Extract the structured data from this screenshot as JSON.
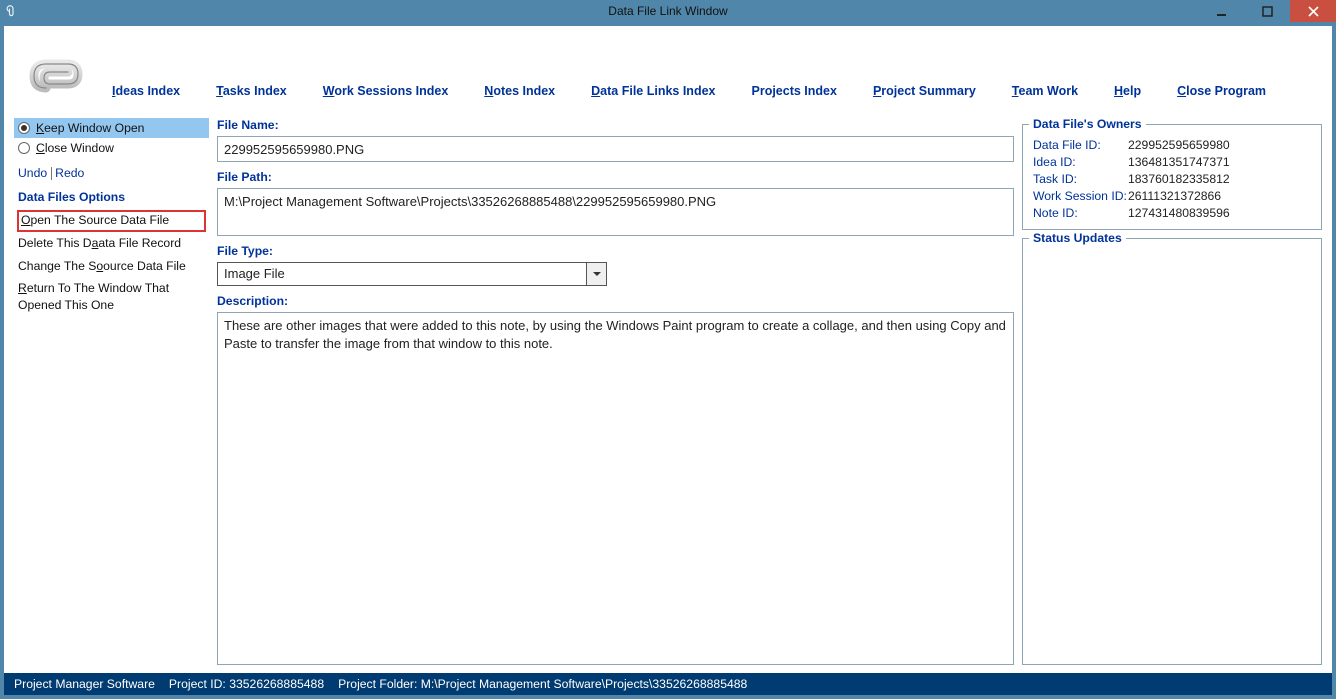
{
  "window": {
    "title": "Data File Link Window"
  },
  "menu": {
    "ideas": "deas Index",
    "tasks": "asks Index",
    "work": "ork Sessions Index",
    "notes": "otes Index",
    "datafile": "ata File Links Index",
    "projects": "Projects Index",
    "summary": "roject Summary",
    "team": "eam Work",
    "help": "elp",
    "close": "lose Program"
  },
  "sidebar": {
    "keep_open": "eep Window Open",
    "close_win": "lose Window",
    "undo": "Undo",
    "redo": "Redo",
    "section": "Data Files Options",
    "open_source": "pen The Source Data File",
    "delete_record": "Delete This D",
    "delete_record2": "ata File Record",
    "change_source": "Change The S",
    "change_source2": "ource Data File",
    "return_txt": "R",
    "return_txt2": "eturn To The Window That Opened This One"
  },
  "fields": {
    "filename_label": "File Name:",
    "filename_value": "229952595659980.PNG",
    "filepath_label": "File Path:",
    "filepath_value": "M:\\Project Management Software\\Projects\\33526268885488\\229952595659980.PNG",
    "filetype_label": "File Type:",
    "filetype_value": "Image File",
    "desc_label": "Description:",
    "desc_value": "These are other images that were added to this note, by using the Windows Paint program to create a collage, and then using Copy and Paste to transfer the image from that window to this note."
  },
  "owners": {
    "title": "Data File's Owners",
    "rows": [
      {
        "k": "Data File ID:",
        "v": "229952595659980"
      },
      {
        "k": "Idea ID:",
        "v": "136481351747371"
      },
      {
        "k": "Task ID:",
        "v": "183760182335812"
      },
      {
        "k": "Work Session ID:",
        "v": "26111321372866"
      },
      {
        "k": "Note ID:",
        "v": "127431480839596"
      }
    ]
  },
  "status_updates": {
    "title": "Status Updates"
  },
  "footer": {
    "app": "Project Manager Software",
    "pid_label": "Project ID:",
    "pid_value": "33526268885488",
    "pfolder_label": "Project Folder:",
    "pfolder_value": "M:\\Project Management Software\\Projects\\33526268885488"
  }
}
